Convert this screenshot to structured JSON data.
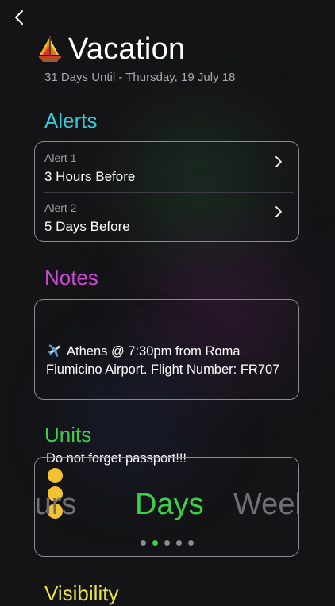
{
  "header": {
    "title": "Vacation",
    "subtitle": "31 Days Until - Thursday, 19 July 18",
    "title_icon": "sailboat-icon"
  },
  "alerts": {
    "title": "Alerts",
    "items": [
      {
        "label": "Alert 1",
        "value": "3 Hours Before"
      },
      {
        "label": "Alert 2",
        "value": "5 Days Before"
      }
    ]
  },
  "notes": {
    "title": "Notes",
    "line1": "Athens @ 7:30pm from Roma Fiumicino Airport. Flight Number: FR707",
    "line2": "Do not forget passport!!!",
    "icons": [
      "airplane-icon",
      "laughing-emoji-icon",
      "crying-emoji-icon",
      "laughing-emoji-icon"
    ]
  },
  "units": {
    "title": "Units",
    "options": [
      "Hours",
      "Days",
      "Weeks"
    ],
    "visible_left": "lours",
    "selected": "Days",
    "visible_right": "Weel",
    "page_count": 5,
    "selected_page": 2
  },
  "visibility": {
    "title": "Visibility"
  },
  "colors": {
    "alerts": "#37c9d9",
    "notes": "#cc48d4",
    "units": "#3dcf47",
    "visibility": "#e7e14a",
    "background": "#141416"
  }
}
